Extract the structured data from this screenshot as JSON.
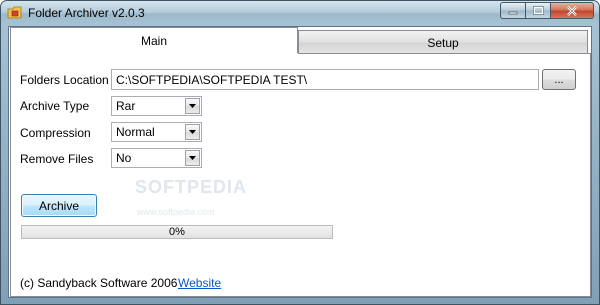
{
  "window": {
    "title": "Folder Archiver v2.0.3",
    "icons": {
      "app": "folder-archive-icon",
      "minimize": "minimize-icon",
      "maximize": "maximize-icon",
      "close": "close-icon"
    }
  },
  "tabs": [
    {
      "label": "Main",
      "active": true
    },
    {
      "label": "Setup",
      "active": false
    }
  ],
  "form": {
    "folders_location_label": "Folders Location",
    "folders_location_value": "C:\\SOFTPEDIA\\SOFTPEDIA TEST\\",
    "browse_label": "...",
    "archive_type_label": "Archive Type",
    "archive_type_value": "Rar",
    "compression_label": "Compression",
    "compression_value": "Normal",
    "remove_files_label": "Remove Files",
    "remove_files_value": "No"
  },
  "actions": {
    "archive_label": "Archive"
  },
  "progress": {
    "value": 0,
    "text": "0%"
  },
  "footer": {
    "copyright": "(c) Sandyback Software 2006",
    "website_label": "Website"
  },
  "watermark": {
    "main": "SOFTPEDIA",
    "sub": "www.softpedia.com"
  },
  "colors": {
    "link": "#0b57c6",
    "progress_fill": "#4fbf4f",
    "active_button": "#bee6fd"
  }
}
